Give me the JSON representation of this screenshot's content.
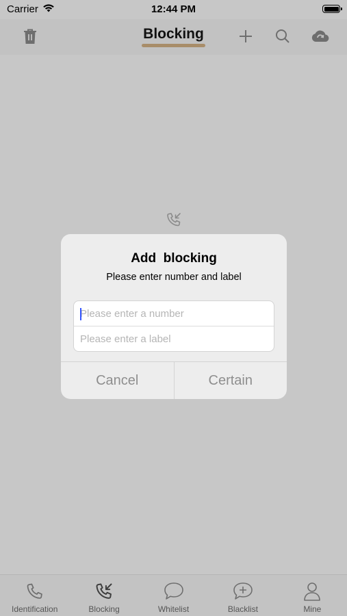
{
  "status_bar": {
    "carrier": "Carrier",
    "time": "12:44 PM"
  },
  "nav": {
    "title": "Blocking",
    "left_icon": "trash-icon",
    "right_icons": [
      "plus-icon",
      "search-icon",
      "cloud-sync-icon"
    ],
    "accent_color": "#a88d69"
  },
  "empty_state": {
    "icon": "incoming-call-icon"
  },
  "dialog": {
    "title": "Add  blocking",
    "message": "Please enter number and label",
    "number_field": {
      "placeholder": "Please enter a number",
      "value": ""
    },
    "label_field": {
      "placeholder": "Please enter a label",
      "value": ""
    },
    "cancel_label": "Cancel",
    "confirm_label": "Certain"
  },
  "tabs": [
    {
      "label": "Identification",
      "icon": "phone-icon"
    },
    {
      "label": "Blocking",
      "icon": "incoming-call-icon",
      "selected": true
    },
    {
      "label": "Whitelist",
      "icon": "chat-bubble-icon"
    },
    {
      "label": "Blacklist",
      "icon": "chat-bubble-plus-icon"
    },
    {
      "label": "Mine",
      "icon": "person-icon"
    }
  ]
}
